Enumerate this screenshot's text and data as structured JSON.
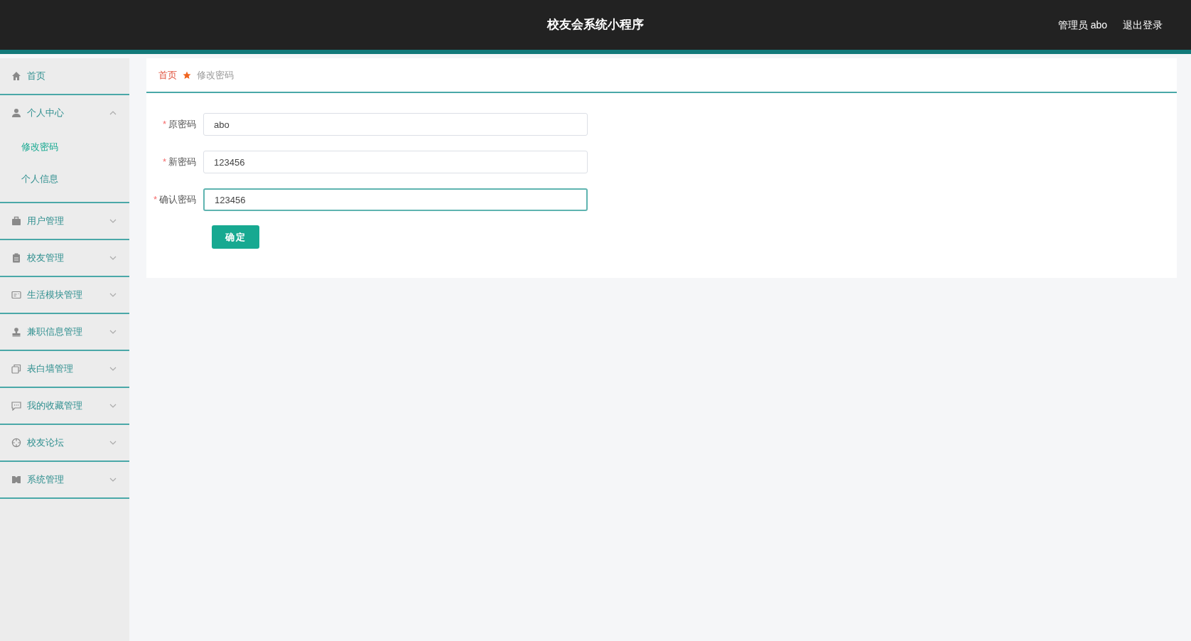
{
  "header": {
    "title": "校友会系统小程序",
    "user": "管理员 abo",
    "logout": "退出登录"
  },
  "sidebar": {
    "items": [
      {
        "kind": "link",
        "label": "首页"
      },
      {
        "kind": "menu",
        "label": "个人中心",
        "expanded": true,
        "children": [
          {
            "label": "修改密码",
            "selected": true
          },
          {
            "label": "个人信息",
            "selected": false
          }
        ]
      },
      {
        "kind": "menu",
        "label": "用户管理",
        "expanded": false
      },
      {
        "kind": "menu",
        "label": "校友管理",
        "expanded": false
      },
      {
        "kind": "menu",
        "label": "生活模块管理",
        "expanded": false
      },
      {
        "kind": "menu",
        "label": "兼职信息管理",
        "expanded": false
      },
      {
        "kind": "menu",
        "label": "表白墙管理",
        "expanded": false
      },
      {
        "kind": "menu",
        "label": "我的收藏管理",
        "expanded": false
      },
      {
        "kind": "menu",
        "label": "校友论坛",
        "expanded": false
      },
      {
        "kind": "menu",
        "label": "系统管理",
        "expanded": false
      }
    ]
  },
  "breadcrumb": {
    "home": "首页",
    "current": "修改密码"
  },
  "form": {
    "required_mark": "*",
    "fields": [
      {
        "label": "原密码",
        "required": true,
        "value": "abo",
        "focused": false
      },
      {
        "label": "新密码",
        "required": true,
        "value": "123456",
        "focused": false
      },
      {
        "label": "确认密码",
        "required": true,
        "value": "123456",
        "focused": true
      }
    ],
    "submit": "确定"
  }
}
